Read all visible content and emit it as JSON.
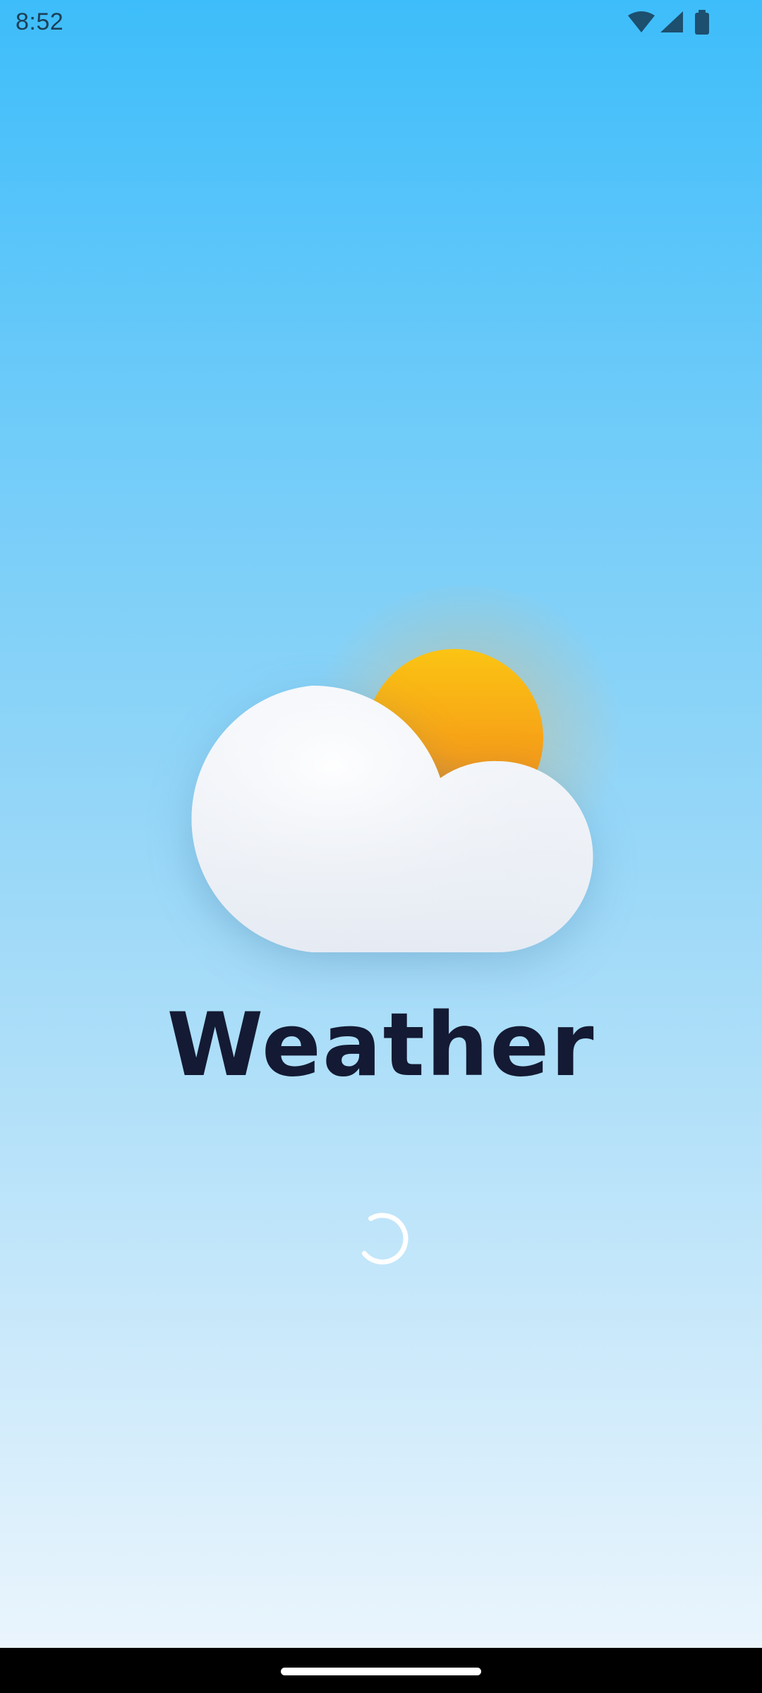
{
  "status_bar": {
    "time": "8:52",
    "icons": [
      "wifi-icon",
      "signal-icon",
      "battery-icon"
    ]
  },
  "splash": {
    "title": "Weather",
    "illustration": [
      "cloud-icon",
      "sun-icon"
    ],
    "loading_indicator": "loading-spinner"
  },
  "colors": {
    "background_top": "#3dbdfa",
    "background_bottom": "#eaf5fd",
    "title": "#141a33",
    "sun": "#f7a616",
    "cloud": "#f4f6fa",
    "status_text": "#1d3f57",
    "nav_bar": "#000000"
  }
}
